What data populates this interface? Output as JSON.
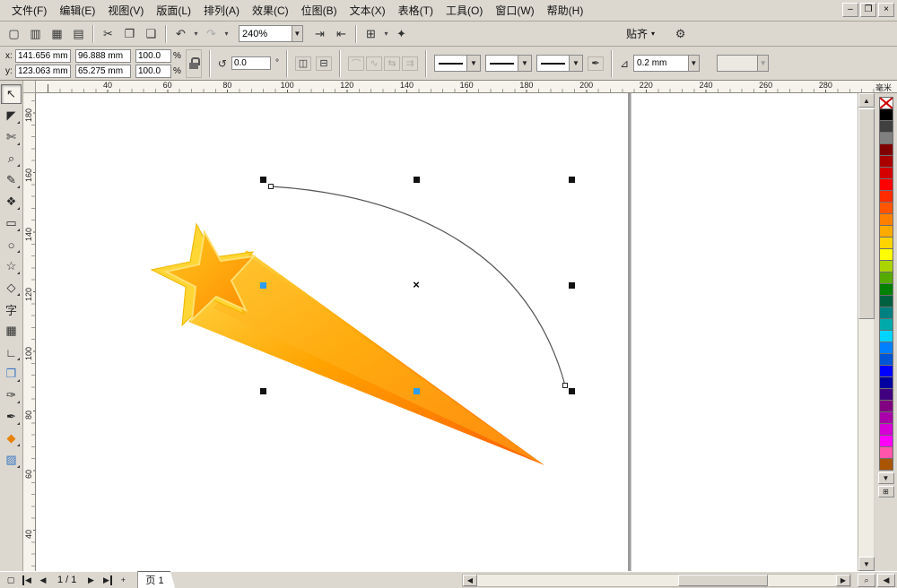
{
  "menubar": {
    "items": [
      "文件(F)",
      "编辑(E)",
      "视图(V)",
      "版面(L)",
      "排列(A)",
      "效果(C)",
      "位图(B)",
      "文本(X)",
      "表格(T)",
      "工具(O)",
      "窗口(W)",
      "帮助(H)"
    ],
    "window_controls": {
      "minimize": "–",
      "restore": "❐",
      "close": "×"
    }
  },
  "toolbar": {
    "buttons_left": [
      {
        "name": "new-document",
        "glyph": "▢"
      },
      {
        "name": "open-document",
        "glyph": "▥"
      },
      {
        "name": "save-document",
        "glyph": "▦"
      },
      {
        "name": "print-document",
        "glyph": "▤"
      },
      {
        "sep": true
      },
      {
        "name": "cut",
        "glyph": "✂"
      },
      {
        "name": "copy",
        "glyph": "❐"
      },
      {
        "name": "paste",
        "glyph": "❑"
      },
      {
        "sep": true
      },
      {
        "name": "undo",
        "glyph": "↶",
        "dropdown": true
      },
      {
        "name": "redo",
        "glyph": "↷",
        "dropdown": true,
        "disabled": true
      }
    ],
    "buttons_right": [
      {
        "name": "import",
        "glyph": "⇥"
      },
      {
        "name": "export",
        "glyph": "⇤"
      },
      {
        "sep": true
      },
      {
        "name": "application-launcher",
        "glyph": "⊞",
        "dropdown": true
      },
      {
        "name": "welcome-screen",
        "glyph": "✦"
      }
    ],
    "zoom_value": "240%",
    "snap_label": "贴齐",
    "snap_arrow": "▾",
    "options_glyph": "⚙"
  },
  "property_bar": {
    "x_label": "x:",
    "x_value": "141.656 mm",
    "y_label": "y:",
    "y_value": "123.063 mm",
    "width_value": "96.888 mm",
    "height_value": "65.275 mm",
    "scale_x_value": "100.0",
    "scale_y_value": "100.0",
    "percent_label": "%",
    "rotate_glyph": "↺",
    "rotation_value": "0.0",
    "degree_label": "°",
    "mirror_h_glyph": "◫",
    "mirror_v_glyph": "⊟",
    "curve_buttons": [
      {
        "name": "convert-to-curve",
        "glyph": "⌒",
        "disabled": true
      },
      {
        "name": "close-curve",
        "glyph": "∿",
        "disabled": true
      },
      {
        "name": "reverse-curve",
        "glyph": "⇆",
        "disabled": true
      },
      {
        "name": "extend-curve",
        "glyph": "⇉",
        "disabled": true
      }
    ],
    "start_arrow": "none",
    "line_style": "solid",
    "end_arrow": "none",
    "outline_pen_glyph": "✒",
    "nib_glyph": "⊿",
    "outline_width_value": "0.2 mm",
    "empty_combo_value": ""
  },
  "toolbox": {
    "tools": [
      {
        "name": "pick-tool",
        "glyph": "↖",
        "selected": true
      },
      {
        "name": "shape-tool",
        "glyph": "◤",
        "flyout": true
      },
      {
        "name": "crop-tool",
        "glyph": "✄",
        "flyout": true
      },
      {
        "name": "zoom-tool",
        "glyph": "⌕",
        "flyout": true
      },
      {
        "name": "freehand-tool",
        "glyph": "✎",
        "flyout": true
      },
      {
        "name": "smart-fill-tool",
        "glyph": "❖",
        "flyout": true
      },
      {
        "name": "rectangle-tool",
        "glyph": "▭",
        "flyout": true
      },
      {
        "name": "ellipse-tool",
        "glyph": "○",
        "flyout": true
      },
      {
        "name": "polygon-tool",
        "glyph": "☆",
        "flyout": true
      },
      {
        "name": "basic-shapes-tool",
        "glyph": "◇",
        "flyout": true
      },
      {
        "name": "text-tool",
        "glyph": "字"
      },
      {
        "name": "table-tool",
        "glyph": "▦"
      },
      {
        "name": "dimension-tool",
        "glyph": "∟",
        "flyout": true
      },
      {
        "name": "interactive-blend-tool",
        "glyph": "❒",
        "flyout": true,
        "color": "#3a78c2"
      },
      {
        "name": "eyedropper-tool",
        "glyph": "✑",
        "flyout": true
      },
      {
        "name": "outline-pen-tool",
        "glyph": "✒",
        "flyout": true
      },
      {
        "name": "fill-tool",
        "glyph": "◆",
        "flyout": true,
        "color": "#e8820c"
      },
      {
        "name": "interactive-fill-tool",
        "glyph": "▨",
        "flyout": true,
        "color": "#3a78c2"
      }
    ]
  },
  "rulers": {
    "unit": "毫米",
    "horizontal": [
      "40",
      "60",
      "80",
      "100",
      "120",
      "140",
      "160",
      "180",
      "200",
      "220",
      "240",
      "260",
      "280"
    ],
    "vertical": [
      "180",
      "160",
      "140",
      "120",
      "100",
      "80",
      "60",
      "40"
    ]
  },
  "selection": {
    "handles": [
      [
        253,
        96
      ],
      [
        424,
        96
      ],
      [
        597,
        96
      ],
      [
        597,
        214
      ],
      [
        253,
        332
      ],
      [
        597,
        332
      ]
    ],
    "blue_handles": [
      [
        253,
        214
      ],
      [
        424,
        332
      ]
    ],
    "center": [
      424,
      214
    ],
    "center_glyph": "×",
    "curve_nodes": [
      [
        262,
        104
      ],
      [
        590,
        326
      ]
    ]
  },
  "artwork": {
    "back_star": "#ffd633",
    "star_light": "#ffc81e",
    "star_dark": "#ff8a00",
    "tail_from": "#ffdc4d",
    "tail_mid": "#ffa300",
    "tail_tip": "#ff5f00",
    "outline": "#ffdf70"
  },
  "palette": {
    "colors": [
      "none",
      "#000000",
      "#404040",
      "#808080",
      "#800000",
      "#aa0000",
      "#d40000",
      "#ff0000",
      "#ff2a00",
      "#ff5500",
      "#ff8000",
      "#ffaa00",
      "#ffd400",
      "#ffff00",
      "#aad400",
      "#55aa00",
      "#008000",
      "#006040",
      "#008080",
      "#00aaaa",
      "#00d4ff",
      "#0080ff",
      "#0055d4",
      "#0000ff",
      "#0000a0",
      "#400080",
      "#800080",
      "#aa00aa",
      "#d400d4",
      "#ff00ff",
      "#ff55aa",
      "#aa5500"
    ],
    "scroll_down_glyph": "▼",
    "flyout_glyph": "⊞"
  },
  "statusbar": {
    "document_glyph": "▢",
    "page_indicator": "1 / 1",
    "page_tab": "页 1",
    "add_page_glyph": "+",
    "zoom_status_glyph": "⌕",
    "palette_flyout_glyph": "◀"
  }
}
